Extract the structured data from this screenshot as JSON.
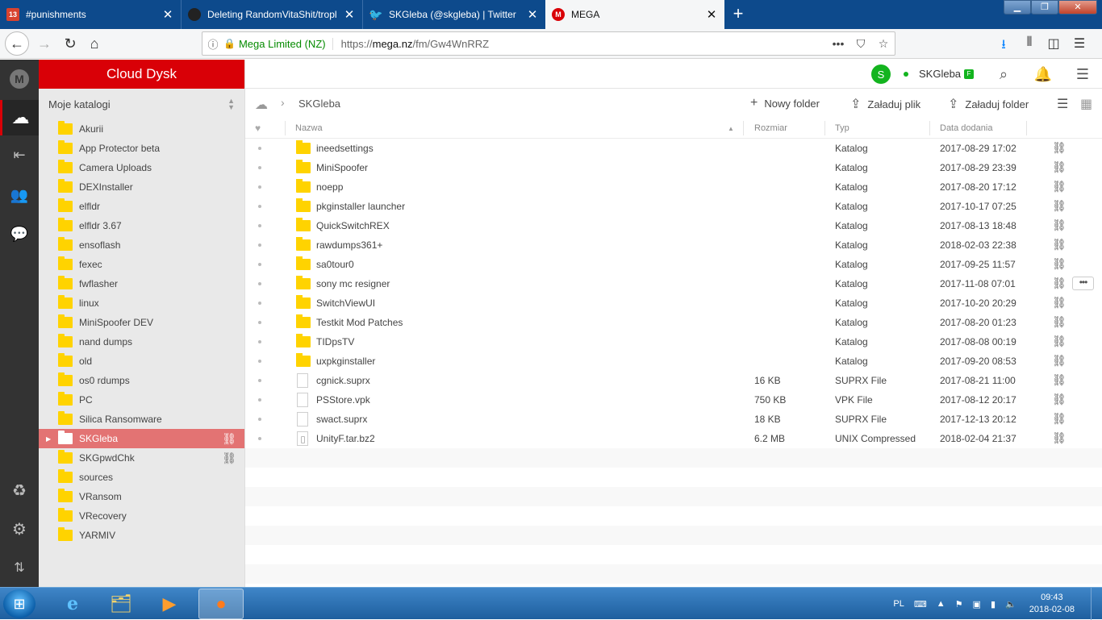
{
  "browser": {
    "tabs": [
      {
        "title": "#punishments",
        "favicon": "discord-icon",
        "badge": "13"
      },
      {
        "title": "Deleting RandomVitaShit/tropl",
        "favicon": "github-icon"
      },
      {
        "title": "SKGleba (@skgleba) | Twitter",
        "favicon": "twitter-icon"
      },
      {
        "title": "MEGA",
        "favicon": "mega-icon"
      }
    ],
    "url_org": "Mega Limited (NZ)",
    "url_prefix": "https://",
    "url_host": "mega.nz",
    "url_path": "/fm/Gw4WnRRZ"
  },
  "sidebar": {
    "header": "Cloud Dysk",
    "subheader": "Moje katalogi",
    "folders": [
      {
        "name": "Akurii"
      },
      {
        "name": "App Protector beta"
      },
      {
        "name": "Camera Uploads"
      },
      {
        "name": "DEXInstaller"
      },
      {
        "name": "elfldr"
      },
      {
        "name": "elfldr 3.67"
      },
      {
        "name": "ensoflash"
      },
      {
        "name": "fexec"
      },
      {
        "name": "fwflasher"
      },
      {
        "name": "linux"
      },
      {
        "name": "MiniSpoofer DEV"
      },
      {
        "name": "nand dumps"
      },
      {
        "name": "old"
      },
      {
        "name": "os0 rdumps"
      },
      {
        "name": "PC"
      },
      {
        "name": "Silica Ransomware"
      },
      {
        "name": "SKGleba",
        "selected": true,
        "shared": true
      },
      {
        "name": "SKGpwdChk",
        "shared": true
      },
      {
        "name": "sources"
      },
      {
        "name": "VRansom"
      },
      {
        "name": "VRecovery"
      },
      {
        "name": "YARMIV"
      }
    ]
  },
  "topbar": {
    "avatar_letter": "S",
    "username": "SKGleba",
    "badge": "F"
  },
  "breadcrumb": {
    "current": "SKGleba"
  },
  "actions": {
    "new_folder": "Nowy folder",
    "upload_file": "Załaduj plik",
    "upload_folder": "Załaduj folder"
  },
  "table": {
    "headers": {
      "name": "Nazwa",
      "size": "Rozmiar",
      "type": "Typ",
      "date": "Data dodania"
    },
    "rows": [
      {
        "name": "ineedsettings",
        "size": "",
        "type": "Katalog",
        "date": "2017-08-29 17:02",
        "kind": "folder"
      },
      {
        "name": "MiniSpoofer",
        "size": "",
        "type": "Katalog",
        "date": "2017-08-29 23:39",
        "kind": "folder"
      },
      {
        "name": "noepp",
        "size": "",
        "type": "Katalog",
        "date": "2017-08-20 17:12",
        "kind": "folder"
      },
      {
        "name": "pkginstaller launcher",
        "size": "",
        "type": "Katalog",
        "date": "2017-10-17 07:25",
        "kind": "folder"
      },
      {
        "name": "QuickSwitchREX",
        "size": "",
        "type": "Katalog",
        "date": "2017-08-13 18:48",
        "kind": "folder"
      },
      {
        "name": "rawdumps361+",
        "size": "",
        "type": "Katalog",
        "date": "2018-02-03 22:38",
        "kind": "folder"
      },
      {
        "name": "sa0tour0",
        "size": "",
        "type": "Katalog",
        "date": "2017-09-25 11:57",
        "kind": "folder"
      },
      {
        "name": "sony mc resigner",
        "size": "",
        "type": "Katalog",
        "date": "2017-11-08 07:01",
        "kind": "folder",
        "hover": true
      },
      {
        "name": "SwitchViewUI",
        "size": "",
        "type": "Katalog",
        "date": "2017-10-20 20:29",
        "kind": "folder"
      },
      {
        "name": "Testkit Mod Patches",
        "size": "",
        "type": "Katalog",
        "date": "2017-08-20 01:23",
        "kind": "folder"
      },
      {
        "name": "TIDpsTV",
        "size": "",
        "type": "Katalog",
        "date": "2017-08-08 00:19",
        "kind": "folder"
      },
      {
        "name": "uxpkginstaller",
        "size": "",
        "type": "Katalog",
        "date": "2017-09-20 08:53",
        "kind": "folder"
      },
      {
        "name": "cgnick.suprx",
        "size": "16 KB",
        "type": "SUPRX File",
        "date": "2017-08-21 11:00",
        "kind": "file"
      },
      {
        "name": "PSStore.vpk",
        "size": "750 KB",
        "type": "VPK File",
        "date": "2017-08-12 20:17",
        "kind": "file"
      },
      {
        "name": "swact.suprx",
        "size": "18 KB",
        "type": "SUPRX File",
        "date": "2017-12-13 20:12",
        "kind": "file"
      },
      {
        "name": "UnityF.tar.bz2",
        "size": "6.2 MB",
        "type": "UNIX Compressed",
        "date": "2018-02-04 21:37",
        "kind": "zip"
      }
    ]
  },
  "taskbar": {
    "lang": "PL",
    "time": "09:43",
    "date": "2018-02-08"
  }
}
